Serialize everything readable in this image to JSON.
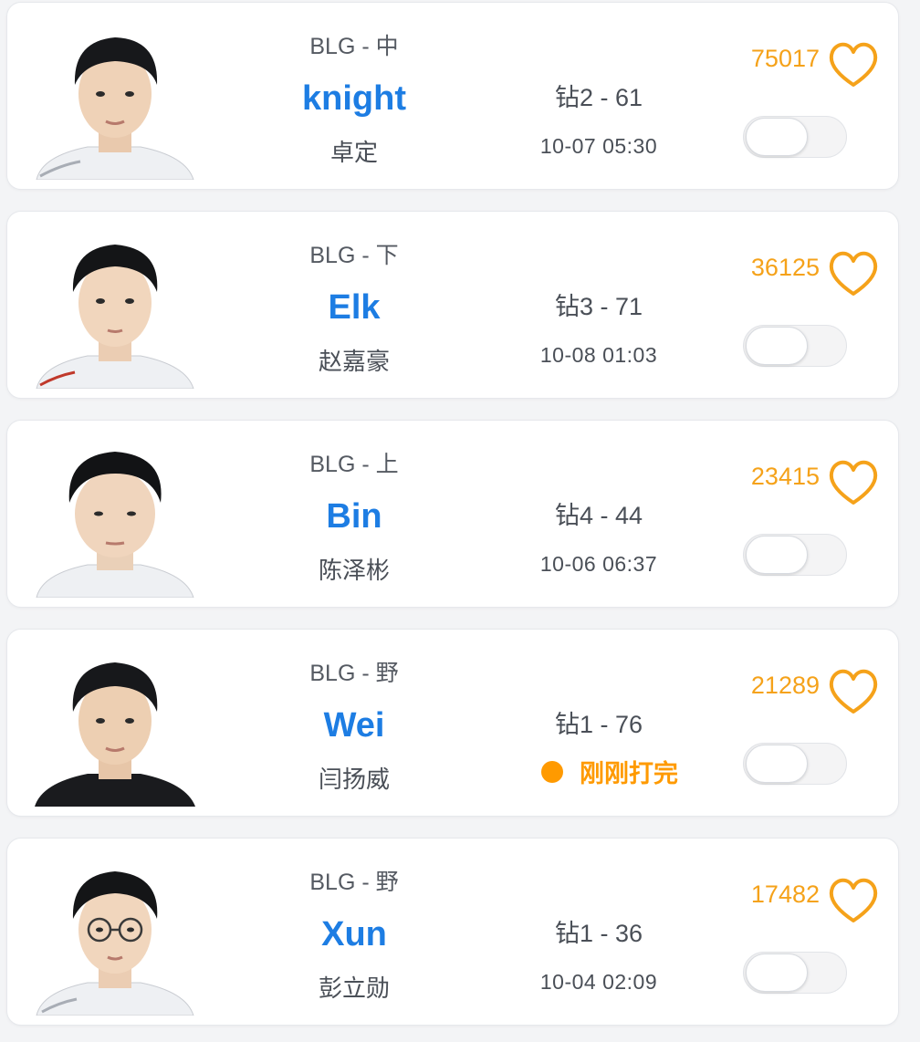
{
  "accent_color": "#1d7de3",
  "like_color": "#f5a21a",
  "status_color": "#ff9a00",
  "players": [
    {
      "team_role": "BLG - 中",
      "name": "knight",
      "real_name": "卓定",
      "rank": "钻2 - 61",
      "last_played": "10-07 05:30",
      "likes": "75017",
      "liked_icon": "heart-outline-icon",
      "subscribed": false
    },
    {
      "team_role": "BLG - 下",
      "name": "Elk",
      "real_name": "赵嘉豪",
      "rank": "钻3 - 71",
      "last_played": "10-08 01:03",
      "likes": "36125",
      "liked_icon": "heart-outline-icon",
      "subscribed": false
    },
    {
      "team_role": "BLG - 上",
      "name": "Bin",
      "real_name": "陈泽彬",
      "rank": "钻4 - 44",
      "last_played": "10-06 06:37",
      "likes": "23415",
      "liked_icon": "heart-outline-icon",
      "subscribed": false
    },
    {
      "team_role": "BLG - 野",
      "name": "Wei",
      "real_name": "闫扬威",
      "rank": "钻1 - 76",
      "status": "刚刚打完",
      "likes": "21289",
      "liked_icon": "heart-outline-icon",
      "subscribed": false
    },
    {
      "team_role": "BLG - 野",
      "name": "Xun",
      "real_name": "彭立勋",
      "rank": "钻1 - 36",
      "last_played": "10-04 02:09",
      "likes": "17482",
      "liked_icon": "heart-outline-icon",
      "subscribed": false
    }
  ]
}
